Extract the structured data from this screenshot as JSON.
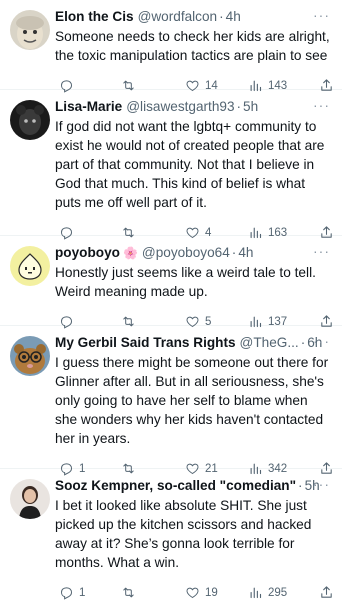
{
  "tweets": [
    {
      "name": "Elon the Cis",
      "handle": "@wordfalcon",
      "time": "4h",
      "text": "Someone needs to check her kids are alright, the toxic manipulation tactics are plain to see",
      "replies": "",
      "likes": "14",
      "views": "143"
    },
    {
      "name": "Lisa-Marie",
      "handle": "@lisawestgarth93",
      "time": "5h",
      "text": "If god did not want the lgbtq+ community to exist he would not of created people that are part of that community. Not that I believe in God that much. This kind of belief is what puts me off well part of it.",
      "replies": "",
      "likes": "4",
      "views": "163"
    },
    {
      "name": "poyoboyo",
      "name_emoji": "🌸",
      "handle": "@poyoboyo64",
      "time": "4h",
      "text": "Honestly just seems like a weird tale to tell. Weird meaning made up.",
      "replies": "",
      "likes": "5",
      "views": "137"
    },
    {
      "name": "My Gerbil Said Trans Rights",
      "handle": "@TheG...",
      "time": "6h",
      "text": "I guess there might be someone out there for Glinner after all. But in all seriousness, she's only going to have her self to blame when she wonders why her kids haven't contacted her in years.",
      "replies": "1",
      "likes": "21",
      "views": "342"
    },
    {
      "name": "Sooz Kempner, so-called \"comedian\"",
      "handle": "",
      "time": "5h",
      "text": "I bet it looked like absolute SHIT. She just picked up the kitchen scissors and hacked away at it? She’s gonna look terrible for months. What a win.",
      "replies": "1",
      "likes": "19",
      "views": "295"
    }
  ],
  "separator": "·",
  "more_glyph": "···",
  "colors": {
    "text": "#0f1419",
    "secondary": "#536471",
    "divider": "#eff3f4",
    "avatar_lisa": "#1a1a1a",
    "avatar_poyo": "#f3f0a0",
    "avatar_gerbil": "#8a6a3a"
  },
  "icons": [
    "reply-icon",
    "retweet-icon",
    "like-icon",
    "views-icon",
    "share-icon",
    "more-icon"
  ]
}
